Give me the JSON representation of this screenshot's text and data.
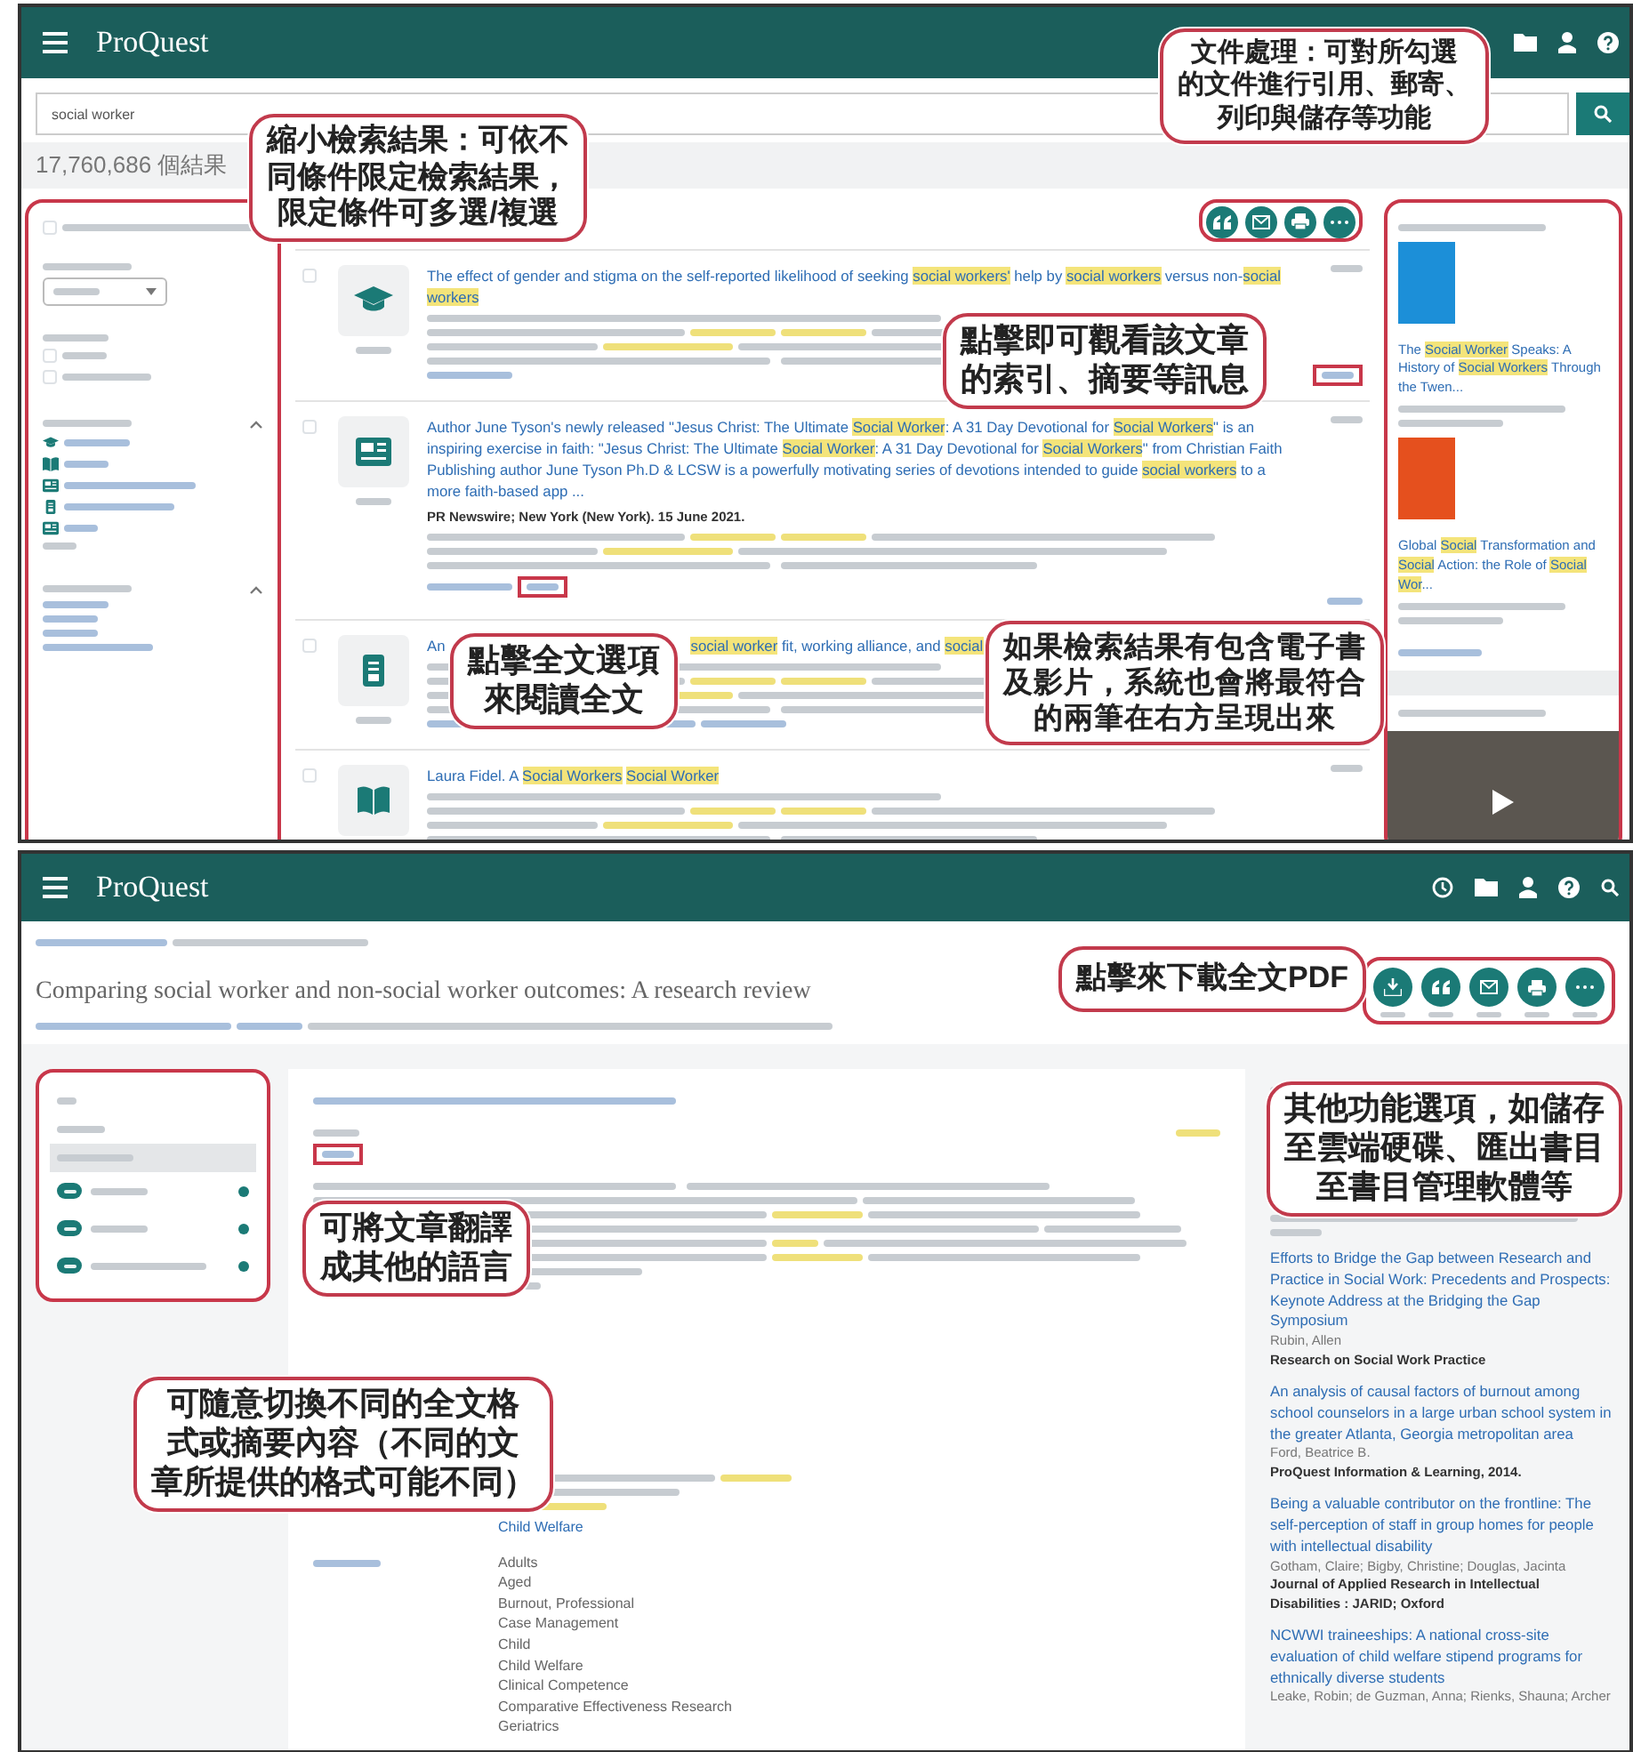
{
  "top_screen": {
    "brand": "ProQuest",
    "search": {
      "value": "social worker"
    },
    "result_count": "17,760,686 個結果",
    "filter_options": [
      {
        "checked": false
      },
      {
        "checked": false
      },
      {
        "checked": false
      }
    ],
    "actions": [
      {
        "kind": "cite"
      },
      {
        "kind": "email"
      },
      {
        "kind": "print"
      },
      {
        "kind": "more"
      }
    ],
    "results": [
      {
        "kind": "scholarly",
        "checked": false,
        "title": "The effect of gender and stigma on the self-reported likelihood of seeking **social workers'** help by **social workers** versus non-**social workers**"
      },
      {
        "kind": "news",
        "checked": false,
        "title": "Author June Tyson's newly released \"Jesus Christ: The Ultimate **Social Worker**: A 31 Day Devotional for **Social Workers**\" is an inspiring exercise in faith: \"Jesus Christ: The Ultimate **Social Worker**: A 31 Day Devotional for **Social Workers**\" from Christian Faith Publishing author June Tyson Ph.D & LCSW is a powerfully motivating series of devotions intended to guide **social workers** to a more faith-based app ...",
        "source": "PR Newswire; New York (New York). 15 June 2021."
      },
      {
        "kind": "dissertation",
        "checked": false,
        "title_start": "An",
        "title": "**social worker** fit, working alliance, and **social**"
      },
      {
        "kind": "book",
        "checked": false,
        "title": "Laura Fidel. A **Social Workers** **Social Worker**"
      }
    ],
    "featured": [
      {
        "kind": "book",
        "color": "#1c8fd8",
        "title": "The **Social Worker** Speaks: A History of **Social Workers** Through the Twen..."
      },
      {
        "kind": "book",
        "color": "#e5501e",
        "title": "Global **Social** Transformation and **Social** Action: the Role of **Social Wor**..."
      },
      {
        "kind": "video"
      }
    ],
    "callouts": [
      {
        "lines": [
          "縮小檢索結果：可依不",
          "同條件限定檢索結果，",
          "限定條件可多選/複選"
        ]
      },
      {
        "lines": [
          "文件處理：可對所勾選",
          "的文件進行引用、郵寄、",
          "列印與儲存等功能"
        ]
      },
      {
        "lines": [
          "點擊即可觀看該文章",
          "的索引、摘要等訊息"
        ]
      },
      {
        "lines": [
          "點擊全文選項",
          "來閱讀全文"
        ]
      },
      {
        "lines": [
          "如果檢索結果有包含電子書",
          "及影片，系統也會將最符合",
          "的兩筆在右方呈現出來"
        ]
      }
    ]
  },
  "bottom_screen": {
    "brand": "ProQuest",
    "title": "Comparing social worker and non-social worker outcomes: A research review",
    "actions": [
      {
        "kind": "download"
      },
      {
        "kind": "cite"
      },
      {
        "kind": "email"
      },
      {
        "kind": "print"
      },
      {
        "kind": "more"
      }
    ],
    "nav": [
      {
        "kind": "link",
        "selected": false
      },
      {
        "kind": "link",
        "selected": false
      },
      {
        "kind": "link",
        "selected": true
      },
      {
        "kind": "counter",
        "selected": false
      },
      {
        "kind": "counter",
        "selected": false
      },
      {
        "kind": "counter",
        "selected": false
      }
    ],
    "subject_terms": [
      "Child Welfare"
    ],
    "mesh_terms": [
      "Adults",
      "Aged",
      "Burnout, Professional",
      "Case Management",
      "Child",
      "Child Welfare",
      "Clinical Competence",
      "Comparative Effectiveness Research",
      "Geriatrics"
    ],
    "related": [
      {
        "title": "Efforts to Bridge the Gap between Research and Practice in Social Work: Precedents and Prospects: Keynote Address at the Bridging the Gap Symposium",
        "authors": "Rubin, Allen",
        "source": "Research on Social Work Practice"
      },
      {
        "title": "An analysis of causal factors of burnout among school counselors in a large urban school system in the greater Atlanta, Georgia metropolitan area",
        "authors": "Ford, Beatrice B.",
        "source": "ProQuest Information & Learning, 2014."
      },
      {
        "title": "Being a valuable contributor on the frontline: The self-perception of staff in group homes for people with intellectual disability",
        "authors": "Gotham, Claire; Bigby, Christine; Douglas, Jacinta",
        "source": "Journal of Applied Research in Intellectual Disabilities : JARID; Oxford"
      },
      {
        "title": "NCWWI traineeships: A national cross-site evaluation of child welfare stipend programs for ethnically diverse students",
        "authors": "Leake, Robin; de Guzman, Anna; Rienks, Shauna; Archer"
      }
    ],
    "callouts": [
      {
        "lines": [
          "點擊來下載全文PDF"
        ]
      },
      {
        "lines": [
          "其他功能選項，如儲存",
          "至雲端硬碟、匯出書目",
          "至書目管理軟體等"
        ]
      },
      {
        "lines": [
          "可將文章翻譯",
          "成其他的語言"
        ]
      },
      {
        "lines": [
          "可隨意切換不同的全文格",
          "式或摘要內容（不同的文",
          "章所提供的格式可能不同）"
        ]
      }
    ]
  }
}
